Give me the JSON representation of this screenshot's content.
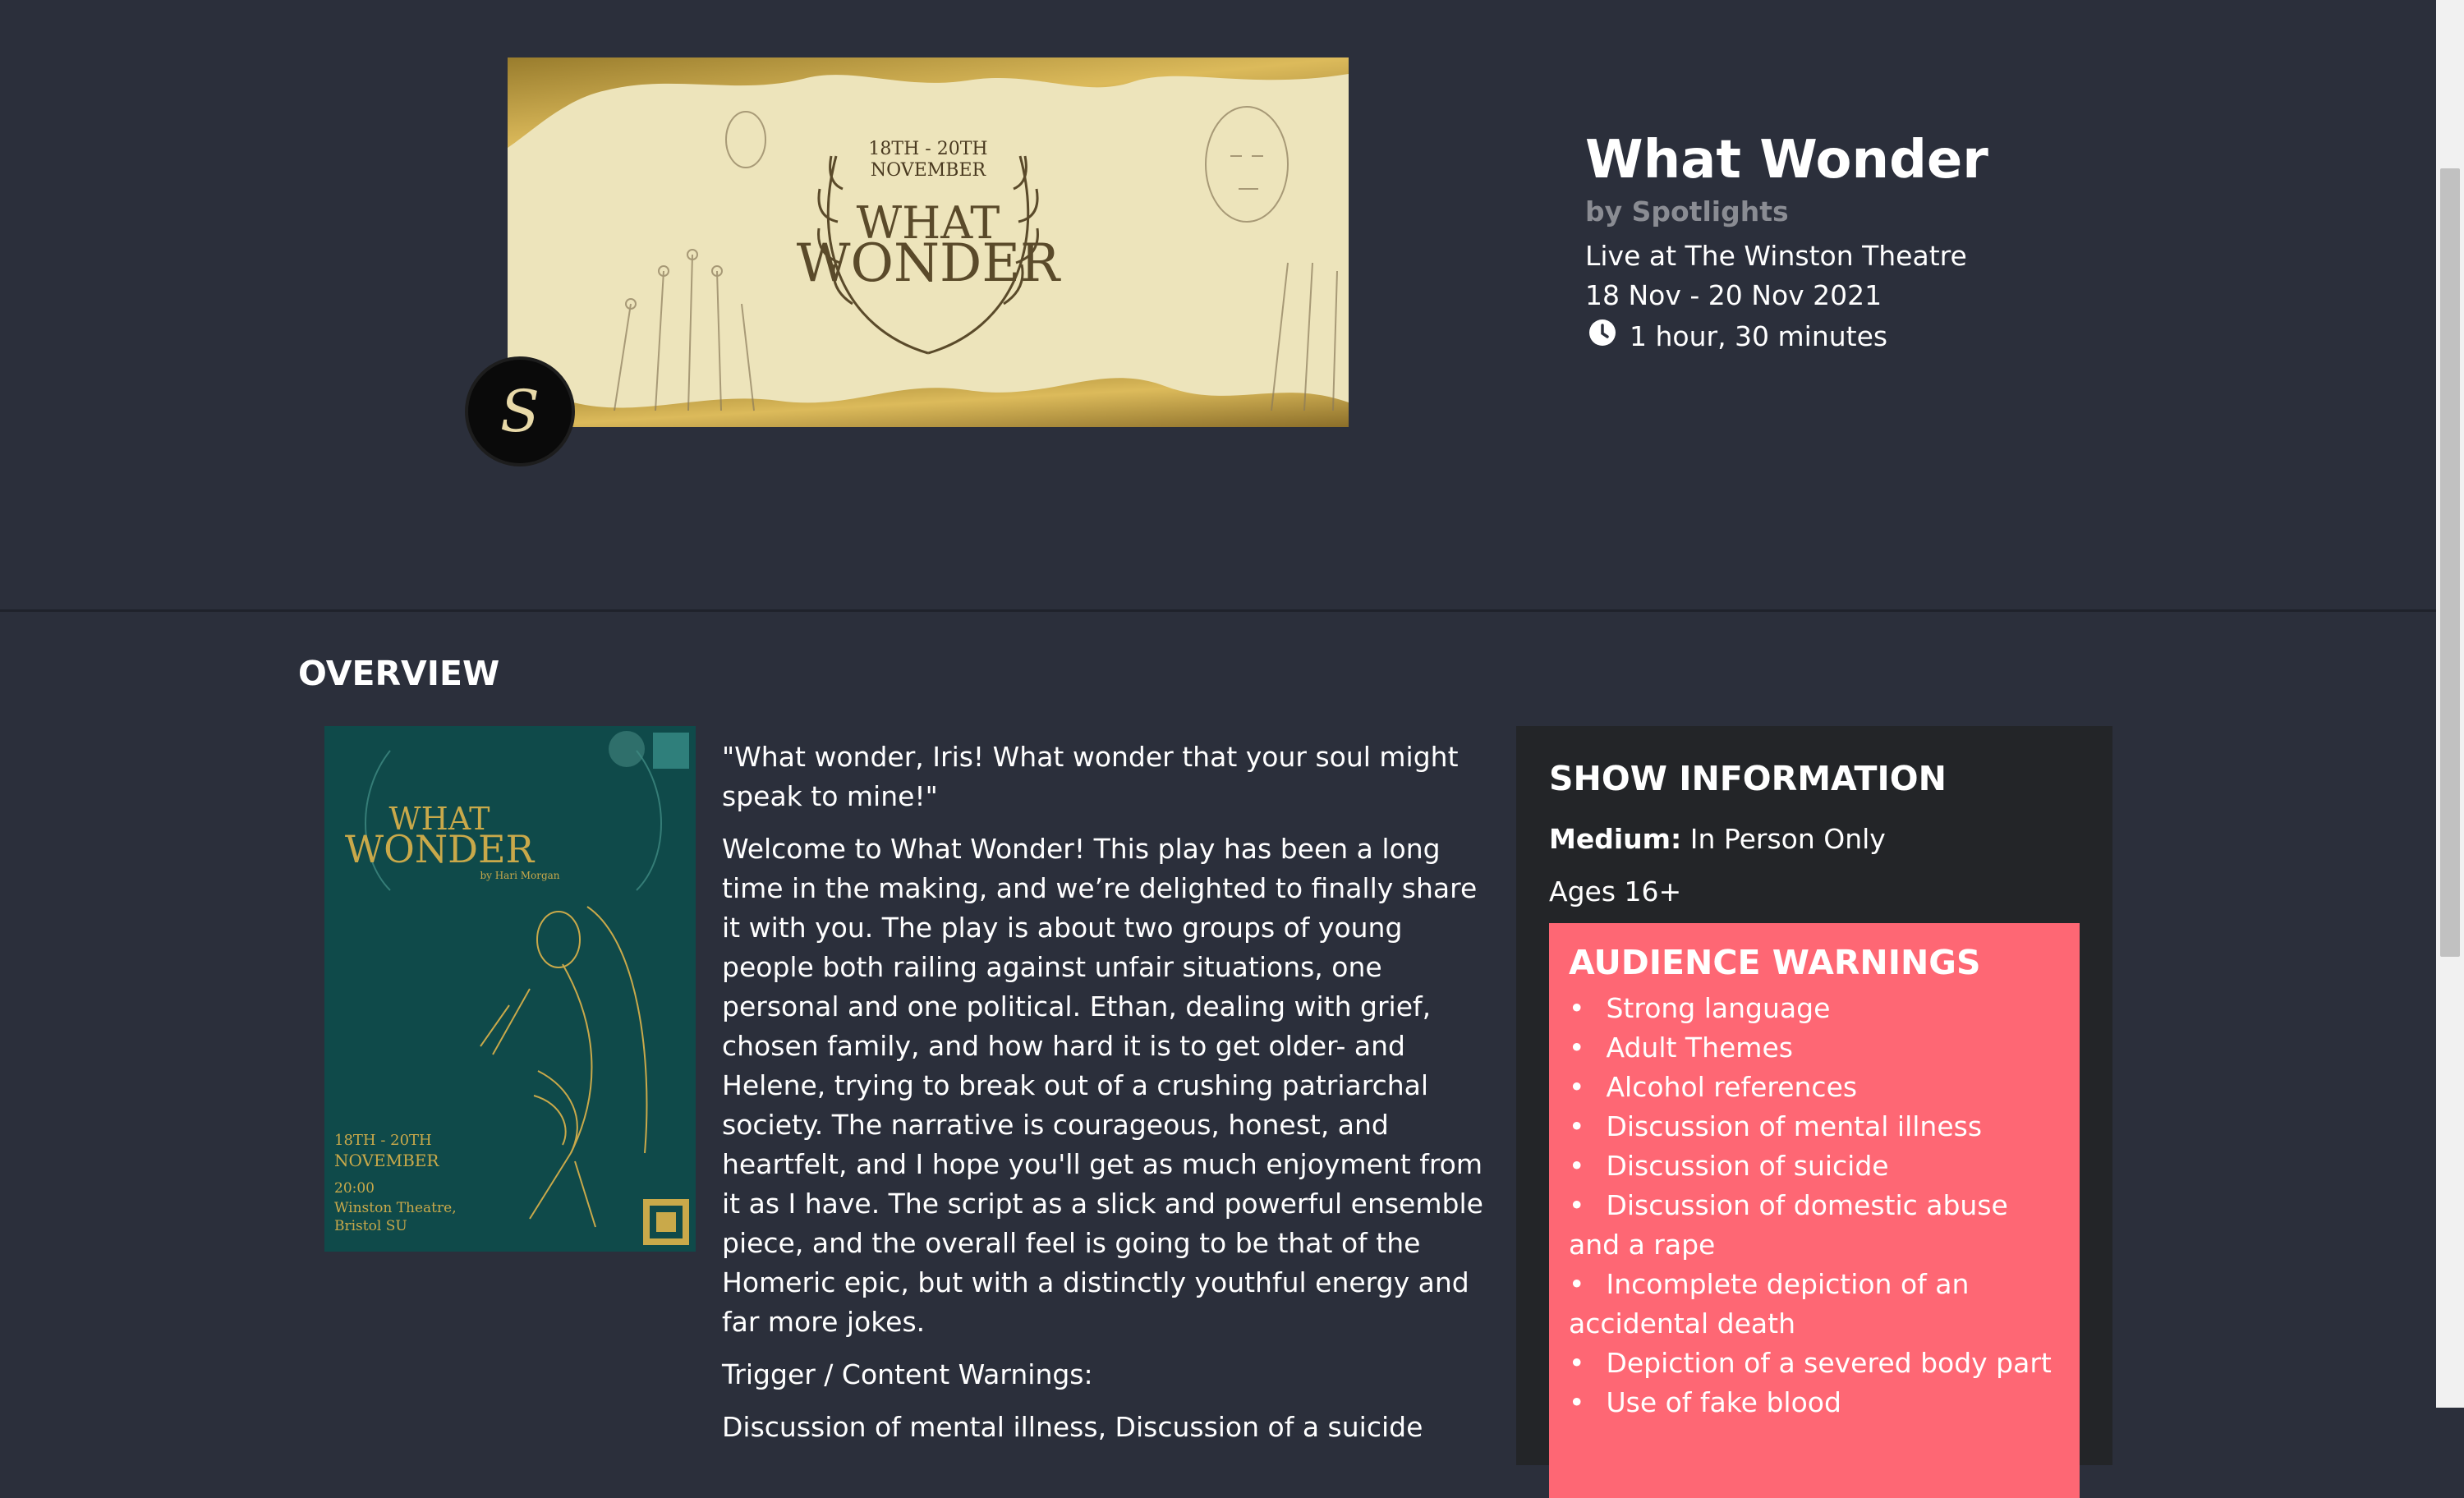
{
  "event": {
    "title": "What Wonder",
    "byline": "by Spotlights",
    "venue": "Live at The Winston Theatre",
    "dates": "18 Nov - 20 Nov 2021",
    "duration": "1 hour, 30 minutes"
  },
  "banner": {
    "dates_line": "18TH - 20TH",
    "month": "NOVEMBER",
    "title_line1": "WHAT",
    "title_line2": "WONDER"
  },
  "logo": {
    "letter": "S"
  },
  "overview": {
    "heading": "OVERVIEW",
    "poster": {
      "title_line1": "WHAT",
      "title_line2": "WONDER",
      "author": "by Hari Morgan",
      "dates": "18TH - 20TH",
      "month": "NOVEMBER",
      "time": "20:00",
      "venue1": "Winston Theatre,",
      "venue2": "Bristol SU"
    },
    "paragraphs": [
      "\"What wonder, Iris! What wonder that your soul might speak to mine!\"",
      "Welcome to What Wonder! This play has been a long time in the making, and we’re delighted to finally share it with you. The play is about two groups of young people both railing against unfair situations, one personal and one political. Ethan, dealing with grief, chosen family, and how hard it is to get older- and Helene, trying to break out of a crushing patriarchal society. The narrative is courageous, honest, and heartfelt, and I hope you'll get as much enjoyment from it as I have. The script as a slick and powerful ensemble piece, and the overall feel is going to be that of the Homeric epic, but with a distinctly youthful energy and far more jokes.",
      "Trigger / Content Warnings:",
      "Discussion of mental illness, Discussion of a suicide"
    ]
  },
  "show_info": {
    "heading": "SHOW INFORMATION",
    "medium_label": "Medium:",
    "medium_value": "In Person Only",
    "ages": "Ages 16+",
    "warnings_heading": "AUDIENCE WARNINGS",
    "warnings": [
      "Strong language",
      "Adult Themes",
      "Alcohol references",
      "Discussion of mental illness",
      "Discussion of suicide",
      "Discussion of domestic abuse and a rape",
      "Incomplete depiction of an accidental death",
      "Depiction of a severed body part",
      "Use of fake blood"
    ]
  },
  "colors": {
    "background": "#2b2f3b",
    "panel": "#232528",
    "warning": "#fe6774",
    "muted": "#8a8c93",
    "poster": "#0f4a4a",
    "gold": "#c9a94a"
  }
}
